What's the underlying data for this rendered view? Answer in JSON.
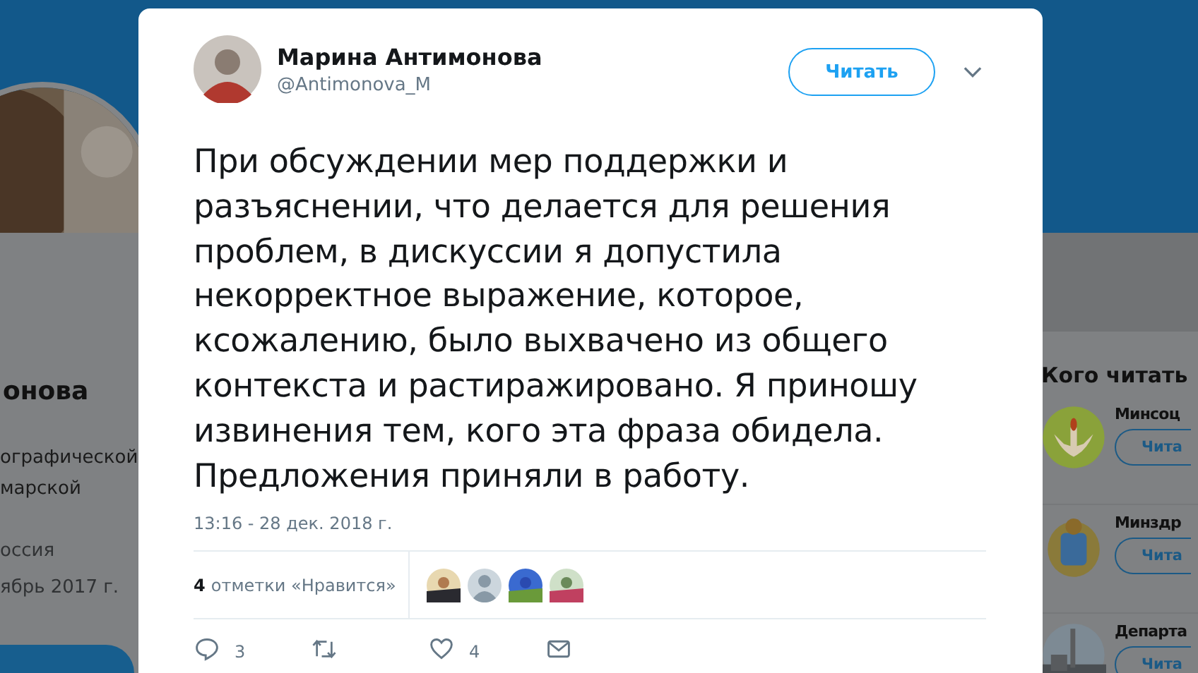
{
  "profile": {
    "name": "онова",
    "bio_lines": [
      "ографической",
      "марской"
    ],
    "location": "оссия",
    "joined": "ябрь 2017 г."
  },
  "who_to_follow": {
    "title": "Кого читать",
    "accounts": [
      {
        "name": "Минсоц",
        "button": "Чита"
      },
      {
        "name": "Минздр",
        "button": "Чита"
      },
      {
        "name": "Департа",
        "button": "Чита"
      }
    ]
  },
  "tweet": {
    "author": {
      "name": "Марина Антимонова",
      "handle": "@Antimonova_M"
    },
    "follow_button": "Читать",
    "text": "При обсуждении мер поддержки и разъяснении, что делается для решения проблем, в дискуссии я допустила некорректное выражение, которое, ксожалению, было выхвачено из общего контекста и растиражировано. Я приношу извинения тем, кого эта фраза обидела. Предложения приняли в работу.",
    "timestamp": "13:16 - 28 дек. 2018 г.",
    "likes": {
      "count": "4",
      "label": "отметки «Нравится»",
      "likers": [
        {
          "kind": "picture"
        },
        {
          "kind": "default"
        },
        {
          "kind": "picture"
        },
        {
          "kind": "picture"
        }
      ]
    },
    "actions": [
      {
        "kind": "reply",
        "count": "3"
      },
      {
        "kind": "retweet"
      },
      {
        "kind": "like",
        "count": "4"
      },
      {
        "kind": "message"
      }
    ]
  }
}
